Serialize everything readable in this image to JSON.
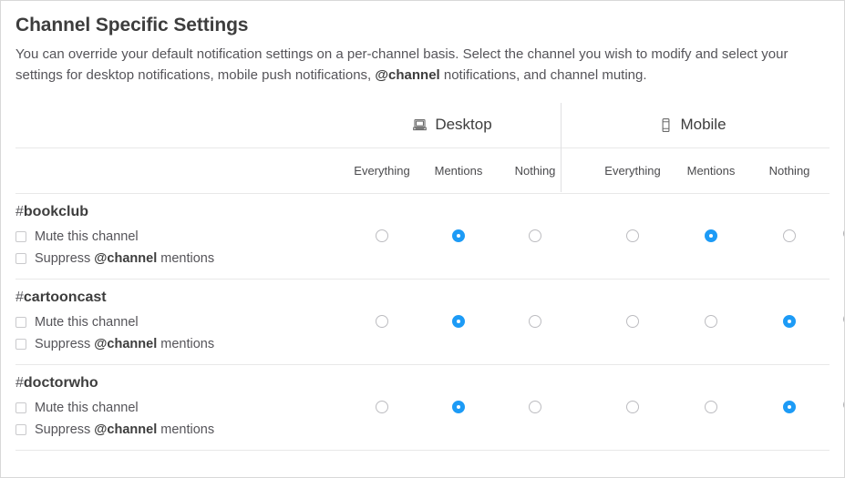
{
  "page": {
    "title": "Channel Specific Settings",
    "description_parts": [
      {
        "text": "You can override your default notification settings on a per-channel basis. Select the channel you wish to modify and select your settings for desktop notifications, mobile push notifications, ",
        "bold": false
      },
      {
        "text": "@channel",
        "bold": true
      },
      {
        "text": " notifications, and channel muting.",
        "bold": false
      }
    ]
  },
  "table": {
    "groups": [
      {
        "id": "desktop",
        "label": "Desktop",
        "icon": "laptop-icon"
      },
      {
        "id": "mobile",
        "label": "Mobile",
        "icon": "phone-icon"
      }
    ],
    "options": [
      "Everything",
      "Mentions",
      "Nothing"
    ],
    "desktop_options": [
      "Everything",
      "Mentions",
      "Nothing"
    ],
    "mobile_options": [
      "Everything",
      "Mentions",
      "Nothing"
    ],
    "remove_icon": "remove-circle-icon",
    "labels": {
      "mute_prefix": "Mute this channel",
      "suppress_pre": "Suppress ",
      "suppress_at": "@channel",
      "suppress_post": " mentions",
      "hash": "#"
    },
    "rows": [
      {
        "channel": "bookclub",
        "mute_checked": false,
        "suppress_checked": false,
        "desktop_selected": "Mentions",
        "mobile_selected": "Mentions"
      },
      {
        "channel": "cartooncast",
        "mute_checked": false,
        "suppress_checked": false,
        "desktop_selected": "Mentions",
        "mobile_selected": "Nothing"
      },
      {
        "channel": "doctorwho",
        "mute_checked": false,
        "suppress_checked": false,
        "desktop_selected": "Mentions",
        "mobile_selected": "Nothing"
      }
    ]
  },
  "colors": {
    "accent_blue": "#1d9bf6",
    "text_primary": "#3d3d3d",
    "text_secondary": "#555459",
    "border": "#e8e8e8"
  }
}
